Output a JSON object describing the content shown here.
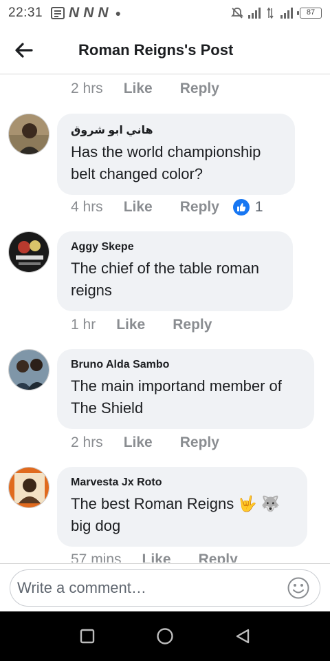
{
  "status": {
    "time": "22:31",
    "battery": "87"
  },
  "header": {
    "title": "Roman Reigns's Post"
  },
  "top_meta": {
    "time": "2 hrs",
    "like": "Like",
    "reply": "Reply"
  },
  "comments": [
    {
      "author": "هاني ابو شروق",
      "text": "Has the world championship belt changed color?",
      "time": "4 hrs",
      "like": "Like",
      "reply": "Reply",
      "reaction_count": "1"
    },
    {
      "author": "Aggy Skepe",
      "text": "The chief of the table roman reigns",
      "time": "1 hr",
      "like": "Like",
      "reply": "Reply"
    },
    {
      "author": "Bruno Alda Sambo",
      "text": "The main importand member of The Shield",
      "time": "2 hrs",
      "like": "Like",
      "reply": "Reply"
    },
    {
      "author": "Marvesta Jx Roto",
      "text": "The best Roman Reigns 🤟 🐺 big dog",
      "time": "57 mins",
      "like": "Like",
      "reply": "Reply"
    }
  ],
  "composer": {
    "placeholder": "Write a comment…"
  },
  "colors": {
    "accent": "#1877f2",
    "bubble": "#f0f2f5",
    "meta": "#8a8d91"
  }
}
